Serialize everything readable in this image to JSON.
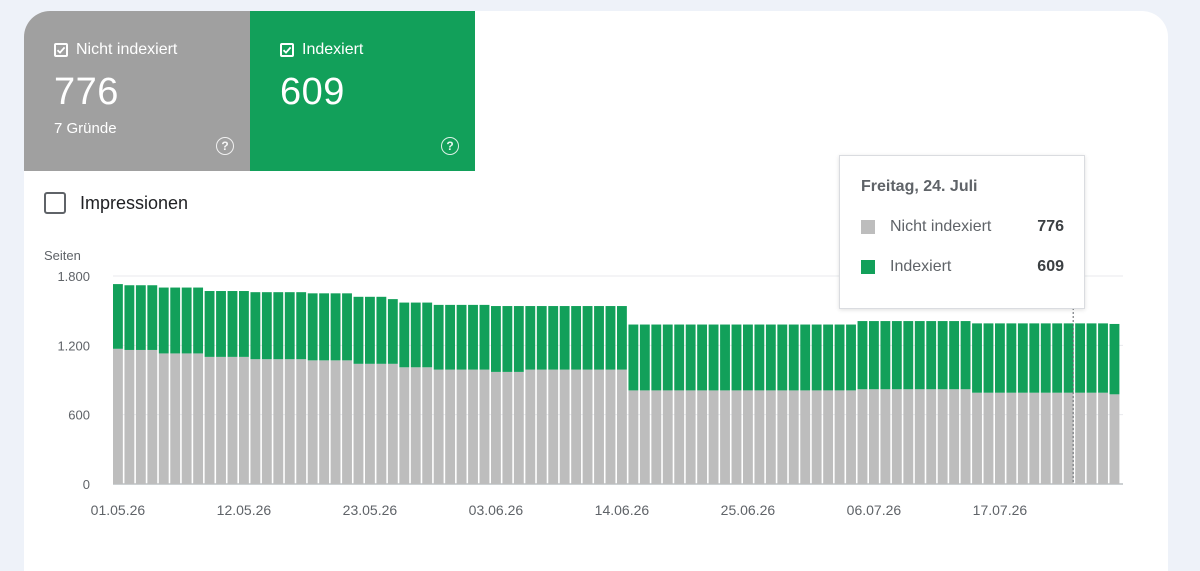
{
  "tiles": {
    "not_indexed": {
      "label": "Nicht indexiert",
      "value": "776",
      "sub": "7 Gründe",
      "color": "#a0a0a0",
      "icon": "checkbox-checked-icon",
      "help_icon": "help-circle-icon",
      "help_glyph": "?"
    },
    "indexed": {
      "label": "Indexiert",
      "value": "609",
      "color": "#12a05a",
      "icon": "checkbox-checked-icon",
      "help_icon": "help-circle-icon",
      "help_glyph": "?"
    }
  },
  "impressions": {
    "label": "Impressionen",
    "checked": false
  },
  "tooltip": {
    "title": "Freitag, 24. Juli",
    "rows": [
      {
        "name": "Nicht indexiert",
        "value": "776",
        "color": "#bdbdbd"
      },
      {
        "name": "Indexiert",
        "value": "609",
        "color": "#12a05a"
      }
    ]
  },
  "chart_data": {
    "type": "bar",
    "stacked": true,
    "ylabel": "Seiten",
    "ylim": [
      0,
      1800
    ],
    "yticks": [
      "0",
      "600",
      "1.200",
      "1.800"
    ],
    "ytick_values": [
      0,
      600,
      1200,
      1800
    ],
    "xtick_labels": [
      "01.05.26",
      "12.05.26",
      "23.05.26",
      "03.06.26",
      "14.06.26",
      "25.06.26",
      "06.07.26",
      "17.07.26"
    ],
    "xtick_indices": [
      0,
      11,
      22,
      33,
      44,
      55,
      66,
      77
    ],
    "grid": true,
    "highlight_index": 84,
    "series": [
      {
        "name": "Nicht indexiert",
        "color": "#bdbdbd",
        "values": [
          1170,
          1160,
          1160,
          1160,
          1130,
          1130,
          1130,
          1130,
          1100,
          1100,
          1100,
          1100,
          1080,
          1080,
          1080,
          1080,
          1080,
          1070,
          1070,
          1070,
          1070,
          1040,
          1040,
          1040,
          1040,
          1010,
          1010,
          1010,
          990,
          990,
          990,
          990,
          990,
          970,
          970,
          970,
          990,
          990,
          990,
          990,
          990,
          990,
          990,
          990,
          990,
          810,
          810,
          810,
          810,
          810,
          810,
          810,
          810,
          810,
          810,
          810,
          810,
          810,
          810,
          810,
          810,
          810,
          810,
          810,
          810,
          820,
          820,
          820,
          820,
          820,
          820,
          820,
          820,
          820,
          820,
          790,
          790,
          790,
          790,
          790,
          790,
          790,
          790,
          790,
          790,
          790,
          790,
          776
        ]
      },
      {
        "name": "Indexiert",
        "color": "#12a05a",
        "values": [
          560,
          560,
          560,
          560,
          570,
          570,
          570,
          570,
          570,
          570,
          570,
          570,
          580,
          580,
          580,
          580,
          580,
          580,
          580,
          580,
          580,
          580,
          580,
          580,
          560,
          560,
          560,
          560,
          560,
          560,
          560,
          560,
          560,
          570,
          570,
          570,
          550,
          550,
          550,
          550,
          550,
          550,
          550,
          550,
          550,
          570,
          570,
          570,
          570,
          570,
          570,
          570,
          570,
          570,
          570,
          570,
          570,
          570,
          570,
          570,
          570,
          570,
          570,
          570,
          570,
          590,
          590,
          590,
          590,
          590,
          590,
          590,
          590,
          590,
          590,
          600,
          600,
          600,
          600,
          600,
          600,
          600,
          600,
          600,
          600,
          600,
          600,
          609
        ]
      }
    ]
  }
}
